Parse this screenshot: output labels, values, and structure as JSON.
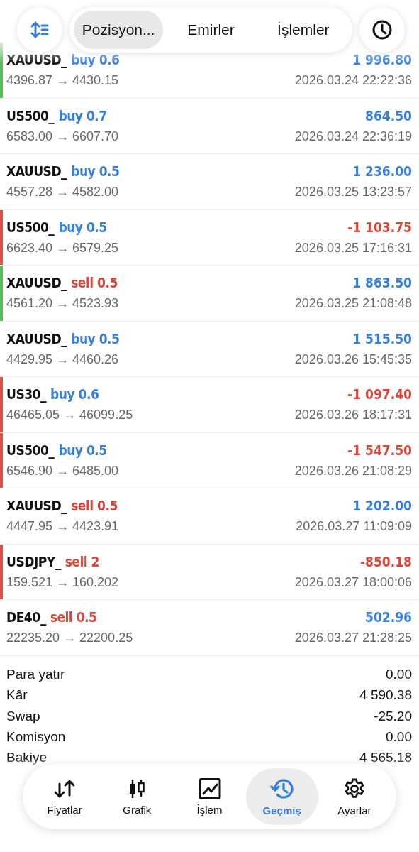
{
  "header": {
    "tabs": [
      {
        "label": "Pozisyon...",
        "selected": true
      },
      {
        "label": "Emirler",
        "selected": false
      },
      {
        "label": "İşlemler",
        "selected": false
      }
    ]
  },
  "deals": [
    {
      "symbol": "XAUUSD_",
      "trade": {
        "text": "buy 0.6",
        "color": "#3a7fd6"
      },
      "prices": "4396.87 → 4430.15",
      "profit": {
        "text": "1 996.80",
        "color": "#3a7fd6"
      },
      "time": "2026.03.24 22:22:36",
      "stripe": {
        "color": "#5cb85c"
      }
    },
    {
      "symbol": "US500_",
      "trade": {
        "text": "buy 0.7",
        "color": "#3a7fd6"
      },
      "prices": "6583.00 → 6607.70",
      "profit": {
        "text": "864.50",
        "color": "#3a7fd6"
      },
      "time": "2026.03.24 22:36:19"
    },
    {
      "symbol": "XAUUSD_",
      "trade": {
        "text": "buy 0.5",
        "color": "#3a7fd6"
      },
      "prices": "4557.28 → 4582.00",
      "profit": {
        "text": "1 236.00",
        "color": "#3a7fd6"
      },
      "time": "2026.03.25 13:23:57"
    },
    {
      "symbol": "US500_",
      "trade": {
        "text": "buy 0.5",
        "color": "#3a7fd6"
      },
      "prices": "6623.40 → 6579.25",
      "profit": {
        "text": "-1 103.75",
        "color": "#d4493c"
      },
      "time": "2026.03.25 17:16:31",
      "stripe": {
        "color": "#d9534f"
      }
    },
    {
      "symbol": "XAUUSD_",
      "trade": {
        "text": "sell 0.5",
        "color": "#d4493c"
      },
      "prices": "4561.20 → 4523.93",
      "profit": {
        "text": "1 863.50",
        "color": "#3a7fd6"
      },
      "time": "2026.03.25 21:08:48",
      "stripe": {
        "color": "#5cb85c"
      }
    },
    {
      "symbol": "XAUUSD_",
      "trade": {
        "text": "buy 0.5",
        "color": "#3a7fd6"
      },
      "prices": "4429.95 → 4460.26",
      "profit": {
        "text": "1 515.50",
        "color": "#3a7fd6"
      },
      "time": "2026.03.26 15:45:35"
    },
    {
      "symbol": "US30_",
      "trade": {
        "text": "buy 0.6",
        "color": "#3a7fd6"
      },
      "prices": "46465.05 → 46099.25",
      "profit": {
        "text": "-1 097.40",
        "color": "#d4493c"
      },
      "time": "2026.03.26 18:17:31",
      "stripe": {
        "color": "#d9534f"
      }
    },
    {
      "symbol": "US500_",
      "trade": {
        "text": "buy 0.5",
        "color": "#3a7fd6"
      },
      "prices": "6546.90 → 6485.00",
      "profit": {
        "text": "-1 547.50",
        "color": "#d4493c"
      },
      "time": "2026.03.26 21:08:29",
      "stripe": {
        "color": "#d9534f"
      }
    },
    {
      "symbol": "XAUUSD_",
      "trade": {
        "text": "sell 0.5",
        "color": "#d4493c"
      },
      "prices": "4447.95 → 4423.91",
      "profit": {
        "text": "1 202.00",
        "color": "#3a7fd6"
      },
      "time": "2026.03.27 11:09:09"
    },
    {
      "symbol": "USDJPY_",
      "trade": {
        "text": "sell 2",
        "color": "#d4493c"
      },
      "prices": "159.521 → 160.202",
      "profit": {
        "text": "-850.18",
        "color": "#d4493c"
      },
      "time": "2026.03.27 18:00:06",
      "stripe": {
        "color": "#d9534f"
      }
    },
    {
      "symbol": "DE40_",
      "trade": {
        "text": "sell 0.5",
        "color": "#d4493c"
      },
      "prices": "22235.20 → 22200.25",
      "profit": {
        "text": "502.96",
        "color": "#3a7fd6"
      },
      "time": "2026.03.27 21:28:25"
    }
  ],
  "summary": [
    {
      "label": "Para yatır",
      "value": "0.00"
    },
    {
      "label": "Kâr",
      "value": "4 590.38"
    },
    {
      "label": "Swap",
      "value": "-25.20"
    },
    {
      "label": "Komisyon",
      "value": "0.00"
    },
    {
      "label": "Bakiye",
      "value": "4 565.18"
    }
  ],
  "nav": [
    {
      "label": "Fiyatlar",
      "kind": "quotes",
      "selected": false
    },
    {
      "label": "Grafik",
      "kind": "chart",
      "selected": false
    },
    {
      "label": "İşlem",
      "kind": "trade",
      "selected": false
    },
    {
      "label": "Geçmiş",
      "kind": "history",
      "selected": true
    },
    {
      "label": "Ayarlar",
      "kind": "settings",
      "selected": false
    }
  ]
}
